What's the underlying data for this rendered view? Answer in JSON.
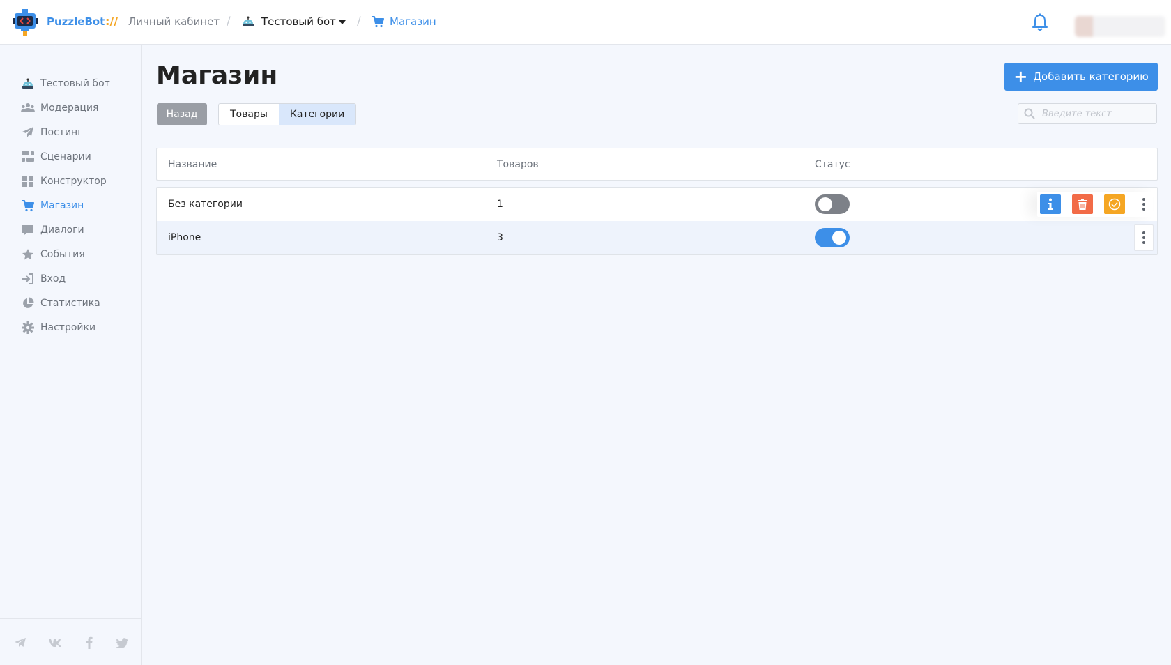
{
  "header": {
    "brand": "PuzzleBot",
    "brand_separator": "://",
    "breadcrumbs": [
      {
        "label": "Личный кабинет"
      },
      {
        "label": "Тестовый бот",
        "icon": "bot-icon",
        "dropdown": true
      },
      {
        "label": "Магазин",
        "icon": "cart-icon"
      }
    ],
    "crumb_separator": "/",
    "notification_icon": "bell-icon"
  },
  "sidebar": {
    "items": [
      {
        "label": "Тестовый бот",
        "icon": "bot-icon"
      },
      {
        "label": "Модерация",
        "icon": "users-icon"
      },
      {
        "label": "Постинг",
        "icon": "paper-plane-icon"
      },
      {
        "label": "Сценарии",
        "icon": "scenarios-icon"
      },
      {
        "label": "Конструктор",
        "icon": "grid-icon"
      },
      {
        "label": "Магазин",
        "icon": "cart-icon",
        "active": true
      },
      {
        "label": "Диалоги",
        "icon": "chat-icon"
      },
      {
        "label": "События",
        "icon": "star-icon"
      },
      {
        "label": "Вход",
        "icon": "sign-in-icon"
      },
      {
        "label": "Статистика",
        "icon": "pie-chart-icon"
      },
      {
        "label": "Настройки",
        "icon": "gear-icon"
      }
    ],
    "social": [
      "telegram-icon",
      "vk-icon",
      "facebook-icon",
      "twitter-icon"
    ]
  },
  "main": {
    "title": "Магазин",
    "add_button_label": "Добавить категорию",
    "back_button_label": "Назад",
    "tabs": [
      {
        "label": "Товары",
        "active": false
      },
      {
        "label": "Категории",
        "active": true
      }
    ],
    "search": {
      "placeholder": "Введите текст",
      "value": ""
    },
    "table": {
      "columns": [
        "Название",
        "Товаров",
        "Статус"
      ],
      "rows": [
        {
          "name": "Без категории",
          "count": "1",
          "status_on": false
        },
        {
          "name": "iPhone",
          "count": "3",
          "status_on": true
        }
      ]
    }
  },
  "colors": {
    "accent": "#3d8fe8",
    "delete": "#f26b47",
    "approve": "#f5a623",
    "brand_separator": "#f5a623"
  }
}
